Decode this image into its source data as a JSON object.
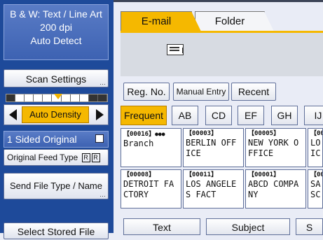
{
  "scan_info": {
    "line1": "B & W: Text / Line Art",
    "line2": "200 dpi",
    "line3": "Auto Detect"
  },
  "left_panel": {
    "scan_settings": "Scan Settings",
    "density_label": "Auto Density",
    "sided_original": "1 Sided Original",
    "feed_type": "Original Feed Type",
    "send_file_type": "Send File Type / Name",
    "select_stored_file": "Select Stored File"
  },
  "tabs": {
    "email": "E-mail",
    "folder": "Folder"
  },
  "dest_buttons": {
    "reg_no": "Reg. No.",
    "manual_entry": "Manual Entry",
    "recent": "Recent"
  },
  "index_tabs": [
    "Frequent",
    "AB",
    "CD",
    "EF",
    "GH",
    "IJ"
  ],
  "destinations": [
    {
      "reg": "【00016】",
      "name1": "Branch",
      "name2": ""
    },
    {
      "reg": "【00003】",
      "name1": "BERLIN OFF",
      "name2": "ICE"
    },
    {
      "reg": "【00005】",
      "name1": "NEW YORK O",
      "name2": "FFICE"
    },
    {
      "reg": "【00",
      "name1": "LO",
      "name2": "IC"
    },
    {
      "reg": "【00008】",
      "name1": "DETROIT FA",
      "name2": "CTORY"
    },
    {
      "reg": "【00011】",
      "name1": "LOS ANGELE",
      "name2": "S FACT"
    },
    {
      "reg": "【00001】",
      "name1": "ABCD COMPA",
      "name2": "NY"
    },
    {
      "reg": "【00",
      "name1": "SA",
      "name2": "SC"
    }
  ],
  "bottom_tabs": [
    "Text",
    "Subject",
    "S"
  ],
  "colors": {
    "accent": "#f5b800",
    "panel": "#1e4a9a"
  }
}
